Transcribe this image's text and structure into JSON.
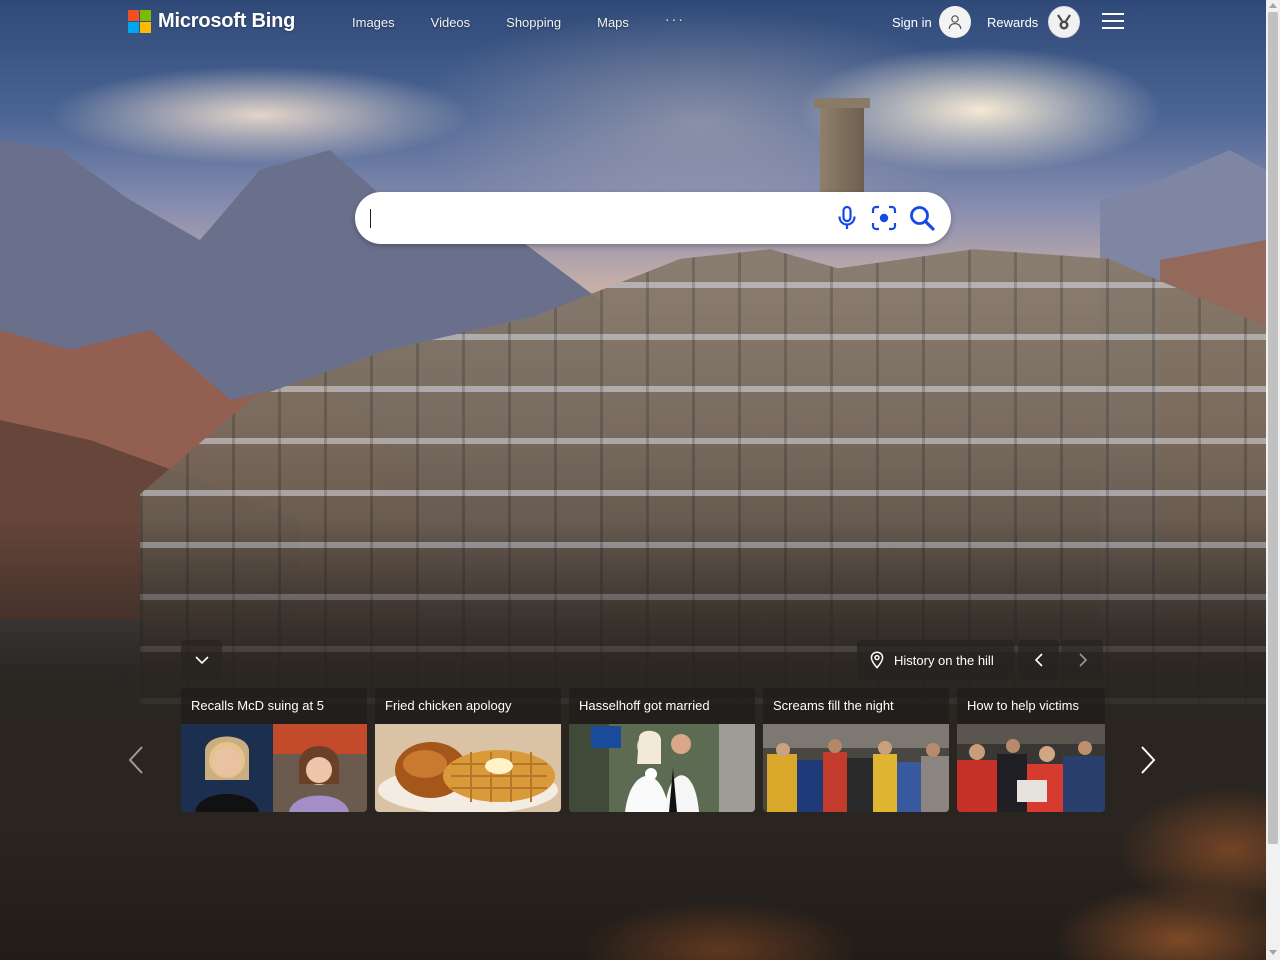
{
  "brand": {
    "name": "Microsoft Bing",
    "colors": [
      "#f25022",
      "#7fba00",
      "#00a4ef",
      "#ffb900"
    ]
  },
  "nav": {
    "items": [
      "Images",
      "Videos",
      "Shopping",
      "Maps"
    ],
    "more": "···"
  },
  "account": {
    "signin_label": "Sign in",
    "rewards_label": "Rewards"
  },
  "search": {
    "value": "",
    "placeholder": "",
    "accent": "#174ae4"
  },
  "image_of_day": {
    "location_label": "History on the hill"
  },
  "news_cards": [
    {
      "title": "Recalls McD suing at 5"
    },
    {
      "title": "Fried chicken apology"
    },
    {
      "title": "Hasselhoff got married"
    },
    {
      "title": "Screams fill the night"
    },
    {
      "title": "How to help victims"
    }
  ],
  "icons": [
    "microphone-icon",
    "visual-search-icon",
    "search-icon",
    "user-icon",
    "medal-icon",
    "menu-icon",
    "chevron-down-icon",
    "location-pin-icon",
    "chevron-left-icon",
    "chevron-right-icon"
  ]
}
